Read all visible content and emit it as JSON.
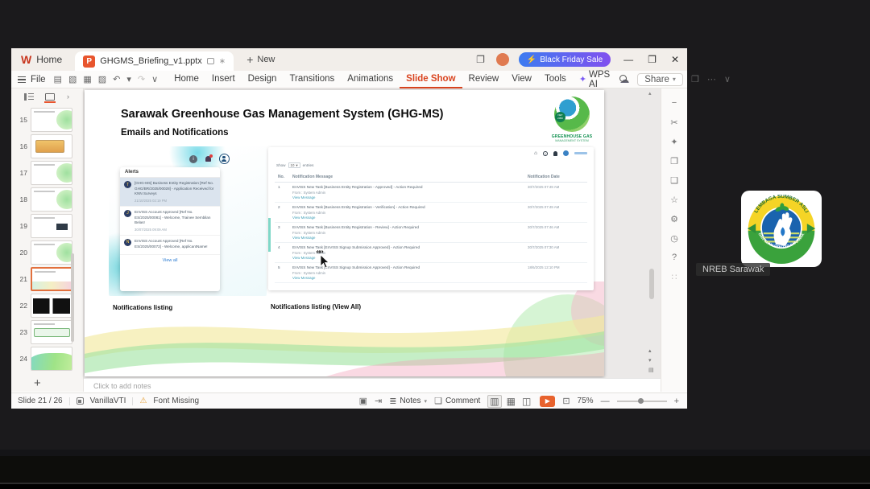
{
  "titlebar": {
    "home_label": "Home",
    "doc_name": "GHGMS_Briefing_v1.pptx",
    "new_label": "New",
    "promo_label": "Black Friday Sale",
    "promo_bolt": "⚡",
    "min": "—",
    "restore": "❐",
    "close": "✕"
  },
  "menubar": {
    "file_label": "File",
    "quick_icons": [
      {
        "name": "save-icon",
        "glyph": "▤"
      },
      {
        "name": "export-icon",
        "glyph": "▧"
      },
      {
        "name": "print-icon",
        "glyph": "▦"
      },
      {
        "name": "print-preview-icon",
        "glyph": "▨"
      },
      {
        "name": "undo-icon",
        "glyph": "↶"
      },
      {
        "name": "undo-caret-icon",
        "glyph": "▾"
      },
      {
        "name": "redo-icon",
        "glyph": "↷",
        "muted": true
      },
      {
        "name": "toolbar-caret-icon",
        "glyph": "∨"
      }
    ],
    "items": [
      {
        "name": "menu-home",
        "label": "Home"
      },
      {
        "name": "menu-insert",
        "label": "Insert"
      },
      {
        "name": "menu-design",
        "label": "Design"
      },
      {
        "name": "menu-transitions",
        "label": "Transitions"
      },
      {
        "name": "menu-animations",
        "label": "Animations"
      },
      {
        "name": "menu-slide-show",
        "label": "Slide Show",
        "active": true
      },
      {
        "name": "menu-review",
        "label": "Review"
      },
      {
        "name": "menu-view",
        "label": "View"
      },
      {
        "name": "menu-tools",
        "label": "Tools"
      }
    ],
    "wps_ai_label": "WPS AI",
    "cloud_glyph": "☁",
    "share_label": "Share",
    "more_glyph": "⋯",
    "panel_glyph": "❒",
    "collapse_glyph": "∨"
  },
  "slide_panel": {
    "thumbs": [
      {
        "name": "slide-thumb-15",
        "num": "15",
        "variant": "green"
      },
      {
        "name": "slide-thumb-16",
        "num": "16",
        "variant": "orange"
      },
      {
        "name": "slide-thumb-17",
        "num": "17",
        "variant": "green"
      },
      {
        "name": "slide-thumb-18",
        "num": "18",
        "variant": "green"
      },
      {
        "name": "slide-thumb-19",
        "num": "19",
        "variant": "dark-chip"
      },
      {
        "name": "slide-thumb-20",
        "num": "20",
        "variant": "green"
      },
      {
        "name": "slide-thumb-21",
        "num": "21",
        "variant": "wave",
        "selected": true
      },
      {
        "name": "slide-thumb-22",
        "num": "22",
        "variant": "black"
      },
      {
        "name": "slide-thumb-23",
        "num": "23",
        "variant": "bar"
      },
      {
        "name": "slide-thumb-24",
        "num": "24",
        "variant": "bigwave"
      }
    ],
    "add_label": "+"
  },
  "slide": {
    "title": "Sarawak Greenhouse Gas Management System (GHG-MS)",
    "subtitle": "Emails and Notifications",
    "logo": {
      "badge": "NET 2050",
      "line1": "GREENHOUSE GAS",
      "line2": "MANAGEMENT SYSTEM"
    },
    "alerts": {
      "title": "Alerts",
      "items": [
        {
          "avatar": "T",
          "text": "[GHG-MS] Business Entity Registration [Ref No. GHG/BR/2025/00028] - Application Received for KNN Surveys",
          "time": "21/10/2025 02:19 PM",
          "highlight": true
        },
        {
          "avatar": "J",
          "text": "EnVISS Account Approved [Ref No. ES/2025/00081] - Welcome, Trainee Sembilan Belas!",
          "time": "30/07/2025 09:09 AM"
        },
        {
          "avatar": "N",
          "text": "EnVISS Account Approved [Ref No. ES/2025/00072] - Welcome, applicantName!",
          "time": ""
        }
      ],
      "view_all": "View all"
    },
    "table": {
      "show_label": "Show",
      "show_value": "10",
      "entries_label": "entries",
      "columns": {
        "no": "No.",
        "message": "Notification Message",
        "date": "Notification Date"
      },
      "rows": [
        {
          "no": "1",
          "msg": "EnVISS New Task [Business Entity Registration - Approved] - Action Required",
          "from": "From : System Admin",
          "link": "View Message",
          "date": "30/7/2025 07:49 AM"
        },
        {
          "no": "2",
          "msg": "EnVISS New Task [Business Entity Registration - Verification] - Action Required",
          "from": "From : System Admin",
          "link": "View Message",
          "date": "30/7/2025 07:49 AM"
        },
        {
          "no": "3",
          "msg": "EnVISS New Task [Business Entity Registration - Review] - Action Required",
          "from": "From : System Admin",
          "link": "View Message",
          "date": "30/7/2025 07:46 AM"
        },
        {
          "no": "4",
          "msg": "EnVISS New Task [EnVISS Signup Submission Approved] - Action Required",
          "from": "From : System Admin",
          "link": "View Message",
          "date": "30/7/2025 07:30 AM"
        },
        {
          "no": "5",
          "msg": "EnVISS New Task [EnVISS Signup Submission Approved] - Action Required",
          "from": "From : System Admin",
          "link": "View Message",
          "date": "18/6/2025 12:10 PM"
        }
      ]
    },
    "caption_left": "Notifications listing",
    "caption_right": "Notifications listing (View All)"
  },
  "right_toolbar": [
    {
      "name": "collapse-panel-icon",
      "glyph": "−"
    },
    {
      "name": "format-tools-icon",
      "glyph": "✂"
    },
    {
      "name": "animation-pane-icon",
      "glyph": "✦"
    },
    {
      "name": "shapes-icon",
      "glyph": "❐"
    },
    {
      "name": "comment-pane-icon",
      "glyph": "❑"
    },
    {
      "name": "favorites-icon",
      "glyph": "☆"
    },
    {
      "name": "settings-icon",
      "glyph": "⚙"
    },
    {
      "name": "history-icon",
      "glyph": "◷"
    },
    {
      "name": "help-icon",
      "glyph": "?"
    },
    {
      "name": "apps-icon",
      "glyph": "∷"
    }
  ],
  "notes": {
    "placeholder": "Click to add notes"
  },
  "statusbar": {
    "slide_info": "Slide 21 / 26",
    "theme_name": "VanillaVTI",
    "warn_glyph": "⚠",
    "font_missing": "Font Missing",
    "left_icons": [
      {
        "name": "slide-size-icon",
        "glyph": "▣"
      },
      {
        "name": "handout-icon",
        "glyph": "⇥"
      }
    ],
    "notes_label": "Notes",
    "comment_label": "Comment",
    "notes_glyph": "≣",
    "comment_glyph": "❑",
    "views": [
      {
        "name": "normal-view-icon",
        "glyph": "▥",
        "selected": true
      },
      {
        "name": "slide-sorter-icon",
        "glyph": "▦"
      },
      {
        "name": "reading-view-icon",
        "glyph": "◫"
      }
    ],
    "play_glyph": "▶",
    "fit_glyph": "⊡",
    "zoom_value": "75%",
    "zoom_out": "—",
    "zoom_in": "+"
  },
  "participant": {
    "name": "NREB Sarawak",
    "logo_top_text": "LEMBAGA SUMBER ASLI",
    "logo_bottom_text": "DAN ALAM SEKITAR SARAWAK"
  },
  "colors": {
    "accent": "#e8552e",
    "promo_from": "#3d7bf0",
    "promo_to": "#8150ef",
    "link": "#3f9fb8"
  }
}
